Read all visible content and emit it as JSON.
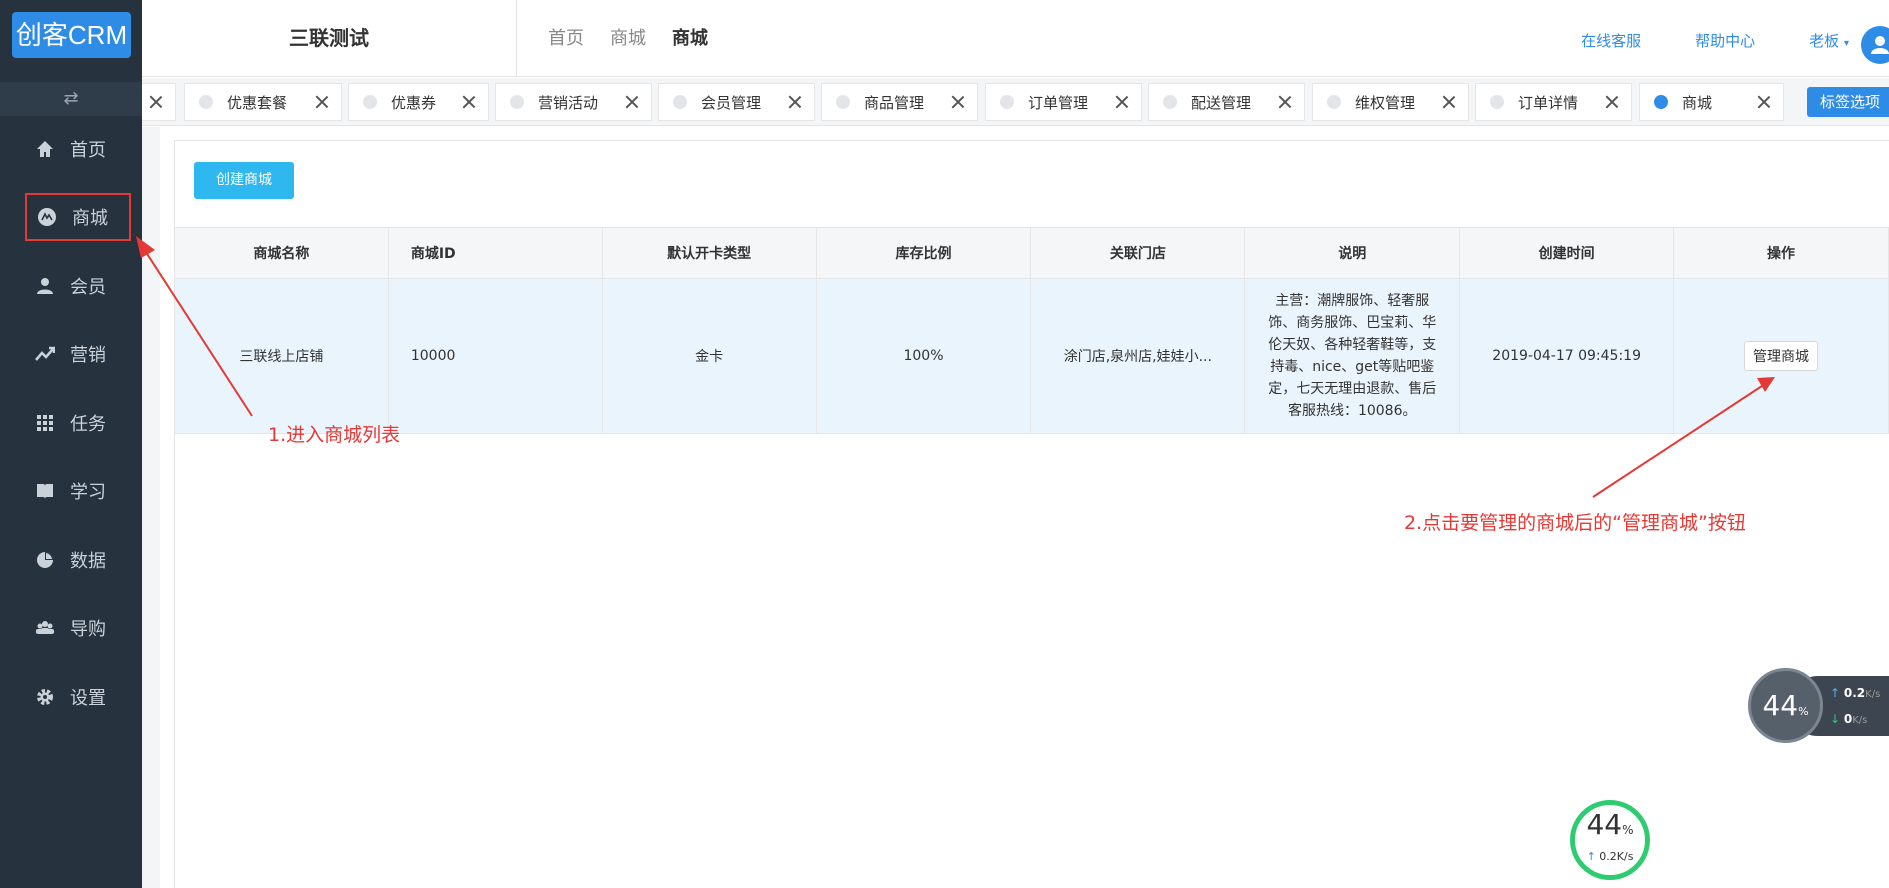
{
  "app": {
    "logo": "创客CRM",
    "company": "三联测试"
  },
  "sidebar": {
    "collapse_icon": "⇄",
    "items": [
      {
        "label": "首页",
        "icon": "home-icon"
      },
      {
        "label": "商城",
        "icon": "mall-icon"
      },
      {
        "label": "会员",
        "icon": "user-icon"
      },
      {
        "label": "营销",
        "icon": "trend-icon"
      },
      {
        "label": "任务",
        "icon": "grid-icon"
      },
      {
        "label": "学习",
        "icon": "book-icon"
      },
      {
        "label": "数据",
        "icon": "pie-icon"
      },
      {
        "label": "导购",
        "icon": "group-icon"
      },
      {
        "label": "设置",
        "icon": "gear-icon"
      }
    ]
  },
  "breadcrumb": [
    "首页",
    "商城",
    "商城"
  ],
  "header_links": {
    "service": "在线客服",
    "help": "帮助中心",
    "user": "老板"
  },
  "tabs": [
    {
      "label": "优惠套餐"
    },
    {
      "label": "优惠券"
    },
    {
      "label": "营销活动"
    },
    {
      "label": "会员管理"
    },
    {
      "label": "商品管理"
    },
    {
      "label": "订单管理"
    },
    {
      "label": "配送管理"
    },
    {
      "label": "维权管理"
    },
    {
      "label": "订单详情"
    },
    {
      "label": "商城",
      "active": true
    }
  ],
  "tab_options": "标签选项",
  "create_button": "创建商城",
  "table": {
    "headers": [
      "商城名称",
      "商城ID",
      "默认开卡类型",
      "库存比例",
      "关联门店",
      "说明",
      "创建时间",
      "操作"
    ],
    "row": {
      "name": "三联线上店铺",
      "id": "10000",
      "card_type": "金卡",
      "stock_ratio": "100%",
      "stores": "涂门店,泉州店,娃娃小...",
      "description": "主营：潮牌服饰、轻奢服饰、商务服饰、巴宝莉、华伦天奴、各种轻奢鞋等，支持毒、nice、get等贴吧鉴定，七天无理由退款、售后客服热线：10086。",
      "created": "2019-04-17 09:45:19",
      "action": "管理商城"
    }
  },
  "annotations": {
    "step1": "1.进入商城列表",
    "step2": "2.点击要管理的商城后的“管理商城”按钮"
  },
  "widgets": {
    "percent": "44",
    "percent_sign": "%",
    "up_speed": "0.2",
    "down_speed": "0",
    "unit": "K/s",
    "speed_small": "0.2K/s"
  },
  "colors": {
    "sidebar": "#26323e",
    "accent": "#2f8ce6",
    "annotation": "#e53935"
  }
}
